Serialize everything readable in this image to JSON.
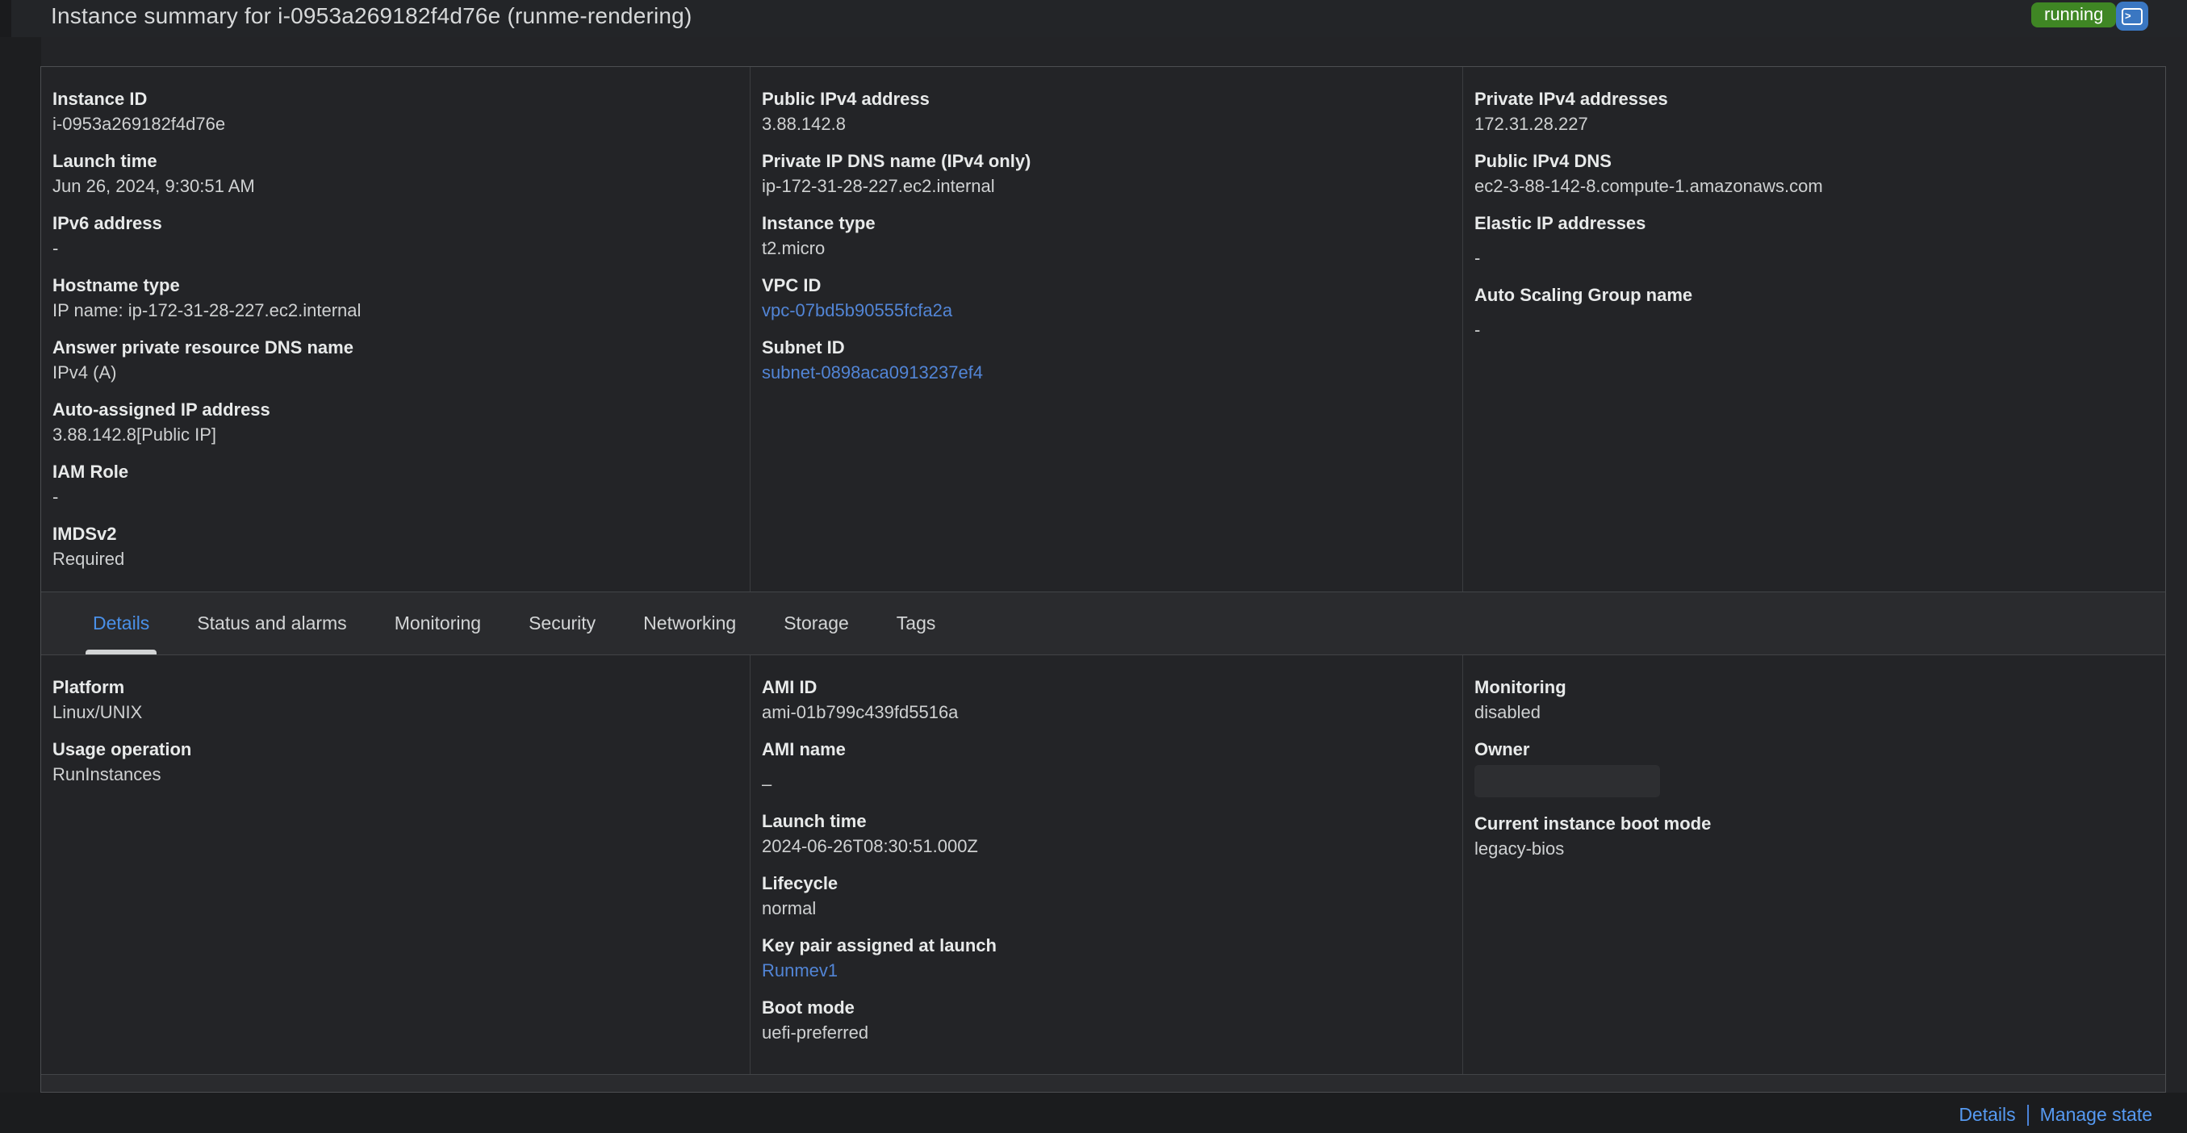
{
  "page": {
    "title": "Instance summary for i-0953a269182f4d76e (runme-rendering)",
    "status": {
      "label": "running",
      "color": "#3f8624"
    },
    "colors": {
      "link": "#5285d6",
      "tab_active": "#4a90e8",
      "terminal_button": "#3a77c2",
      "footer_link": "#569af2"
    }
  },
  "summary_panel": {
    "columns": [
      {
        "fields": [
          {
            "label": "Instance ID",
            "value": "i-0953a269182f4d76e",
            "type": "text"
          },
          {
            "label": "Launch time",
            "value": "Jun 26, 2024, 9:30:51 AM",
            "type": "text"
          },
          {
            "label": "IPv6 address",
            "value": "-",
            "type": "text"
          },
          {
            "label": "Hostname type",
            "value": "IP name: ip-172-31-28-227.ec2.internal",
            "type": "text"
          },
          {
            "label": "Answer private resource DNS name",
            "value": "IPv4 (A)",
            "type": "text"
          },
          {
            "label": "Auto-assigned IP address",
            "value": "3.88.142.8[Public IP]",
            "type": "text"
          },
          {
            "label": "IAM Role",
            "value": "-",
            "type": "text"
          },
          {
            "label": "IMDSv2",
            "value": "Required",
            "type": "text"
          }
        ]
      },
      {
        "fields": [
          {
            "label": "Public IPv4 address",
            "value": "3.88.142.8",
            "type": "text"
          },
          {
            "label": "Private IP DNS name (IPv4 only)",
            "value": "ip-172-31-28-227.ec2.internal",
            "type": "text"
          },
          {
            "label": "Instance type",
            "value": "t2.micro",
            "type": "text"
          },
          {
            "label": "VPC ID",
            "value": "vpc-07bd5b90555fcfa2a",
            "type": "link"
          },
          {
            "label": "Subnet ID",
            "value": "subnet-0898aca0913237ef4",
            "type": "link"
          }
        ]
      },
      {
        "fields": [
          {
            "label": "Private IPv4 addresses",
            "value": "172.31.28.227",
            "type": "text"
          },
          {
            "label": "Public IPv4 DNS",
            "value": "ec2-3-88-142-8.compute-1.amazonaws.com",
            "type": "text"
          },
          {
            "label": "Elastic IP addresses",
            "value": "-",
            "type": "text"
          },
          {
            "label": "Auto Scaling Group name",
            "value": "-",
            "type": "text"
          }
        ]
      }
    ]
  },
  "tabs": [
    {
      "label": "Details",
      "active": true
    },
    {
      "label": "Status and alarms",
      "active": false
    },
    {
      "label": "Monitoring",
      "active": false
    },
    {
      "label": "Security",
      "active": false
    },
    {
      "label": "Networking",
      "active": false
    },
    {
      "label": "Storage",
      "active": false
    },
    {
      "label": "Tags",
      "active": false
    }
  ],
  "details_panel": {
    "columns": [
      {
        "fields": [
          {
            "label": "Platform",
            "value": "Linux/UNIX",
            "type": "text"
          },
          {
            "label": "Usage operation",
            "value": "RunInstances",
            "type": "text"
          }
        ]
      },
      {
        "fields": [
          {
            "label": "AMI ID",
            "value": "ami-01b799c439fd5516a",
            "type": "text"
          },
          {
            "label": "AMI name",
            "value": "–",
            "type": "text"
          },
          {
            "label": "Launch time",
            "value": "2024-06-26T08:30:51.000Z",
            "type": "text"
          },
          {
            "label": "Lifecycle",
            "value": "normal",
            "type": "text"
          },
          {
            "label": "Key pair assigned at launch",
            "value": "Runmev1",
            "type": "link"
          },
          {
            "label": "Boot mode",
            "value": "uefi-preferred",
            "type": "text"
          }
        ]
      },
      {
        "fields": [
          {
            "label": "Monitoring",
            "value": "disabled",
            "type": "text"
          },
          {
            "label": "Owner",
            "value": "",
            "type": "redacted"
          },
          {
            "label": "Current instance boot mode",
            "value": "legacy-bios",
            "type": "text"
          }
        ]
      }
    ]
  },
  "footer": {
    "links": [
      "Details",
      "Manage state"
    ]
  }
}
